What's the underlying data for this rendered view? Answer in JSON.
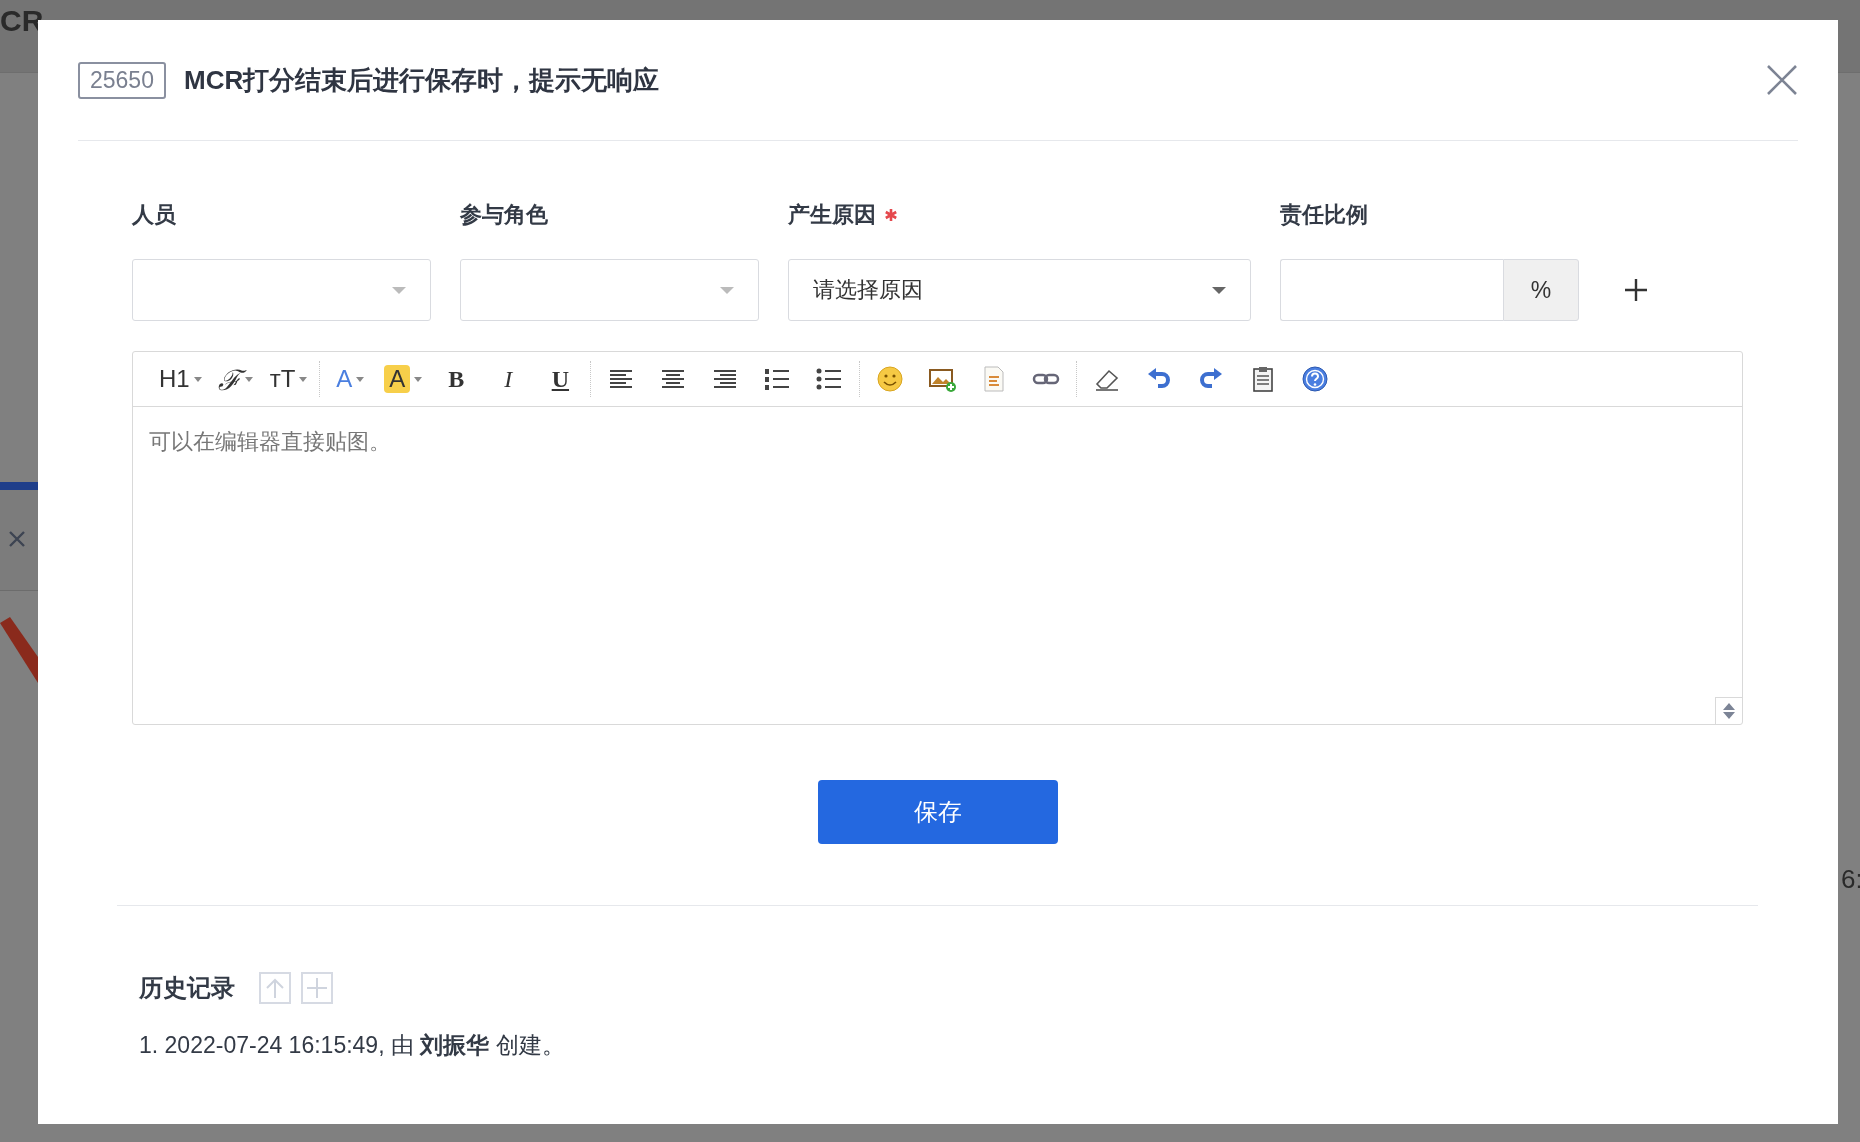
{
  "background": {
    "title_fragment": "CR",
    "right_fragment": "6:"
  },
  "dialog": {
    "id_badge": "25650",
    "title": "MCR打分结束后进行保存时，提示无响应"
  },
  "fields": [
    {
      "label": "人员",
      "kind": "select",
      "required": false
    },
    {
      "label": "参与角色",
      "kind": "select",
      "required": false
    },
    {
      "label": "产生原因",
      "kind": "select",
      "required": true,
      "placeholder": "请选择原因"
    },
    {
      "label": "责任比例",
      "kind": "percent",
      "required": false,
      "addon": "%"
    }
  ],
  "toolbar": [
    [
      {
        "kind": "text",
        "label": "H1",
        "dropdown": true
      },
      {
        "kind": "script",
        "label": "ℱ",
        "dropdown": true
      },
      {
        "kind": "text",
        "label": "ᴛT",
        "dropdown": true
      }
    ],
    [
      {
        "kind": "color",
        "label": "A",
        "dropdown": true
      },
      {
        "kind": "highlight",
        "label": "A",
        "dropdown": true
      },
      {
        "kind": "bold",
        "label": "B",
        "dropdown": false
      },
      {
        "kind": "italic",
        "label": "I",
        "dropdown": false
      },
      {
        "kind": "underline",
        "label": "U",
        "dropdown": false
      }
    ],
    [
      {
        "kind": "icon"
      },
      {
        "kind": "icon"
      },
      {
        "kind": "icon"
      },
      {
        "kind": "icon"
      },
      {
        "kind": "icon"
      }
    ],
    [
      {
        "kind": "icon"
      },
      {
        "kind": "icon"
      },
      {
        "kind": "icon"
      },
      {
        "kind": "icon"
      }
    ],
    [
      {
        "kind": "icon"
      },
      {
        "kind": "icon"
      },
      {
        "kind": "icon"
      },
      {
        "kind": "icon"
      },
      {
        "kind": "icon"
      }
    ]
  ],
  "editor": {
    "placeholder": "可以在编辑器直接贴图。"
  },
  "save_button": "保存",
  "history": {
    "title": "历史记录",
    "entries": [
      "1. 2022-07-24 16:15:49, 由 **刘振华** 创建。"
    ]
  }
}
